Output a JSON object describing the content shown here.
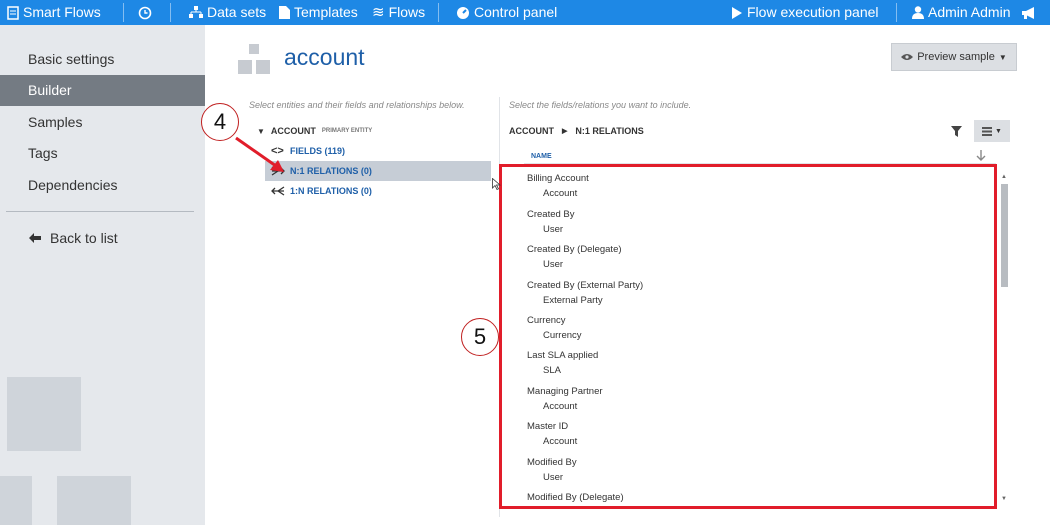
{
  "topbar": {
    "brand": "Smart Flows",
    "nav": [
      "Data sets",
      "Templates",
      "Flows",
      "Control panel"
    ],
    "flow_panel": "Flow execution panel",
    "user": "Admin Admin"
  },
  "sidebar": {
    "items": [
      "Basic settings",
      "Builder",
      "Samples",
      "Tags",
      "Dependencies"
    ],
    "active": "Builder",
    "back": "Back to list"
  },
  "page": {
    "title": "account",
    "preview_button": "Preview sample"
  },
  "left_panel": {
    "hint": "Select entities and their fields and relationships below.",
    "root_label": "ACCOUNT",
    "root_tag": "PRIMARY ENTITY",
    "items": [
      "FIELDS (119)",
      "N:1 RELATIONS (0)",
      "1:N RELATIONS (0)"
    ]
  },
  "right_panel": {
    "hint": "Select the fields/relations you want to include.",
    "breadcrumb": [
      "ACCOUNT",
      "N:1 RELATIONS"
    ],
    "column_header": "NAME",
    "rows": [
      {
        "name": "Billing Account",
        "entity": "Account"
      },
      {
        "name": "Created By",
        "entity": "User"
      },
      {
        "name": "Created By (Delegate)",
        "entity": "User"
      },
      {
        "name": "Created By (External Party)",
        "entity": "External Party"
      },
      {
        "name": "Currency",
        "entity": "Currency"
      },
      {
        "name": "Last SLA applied",
        "entity": "SLA"
      },
      {
        "name": "Managing Partner",
        "entity": "Account"
      },
      {
        "name": "Master ID",
        "entity": "Account"
      },
      {
        "name": "Modified By",
        "entity": "User"
      },
      {
        "name": "Modified By (Delegate)",
        "entity": ""
      }
    ]
  },
  "annotations": {
    "callout_4": "4",
    "callout_5": "5",
    "highlight_color": "#e11d2a"
  },
  "colors": {
    "topbar": "#1e88e5",
    "link": "#1e5fa8",
    "sidebar_active": "#747b83"
  }
}
